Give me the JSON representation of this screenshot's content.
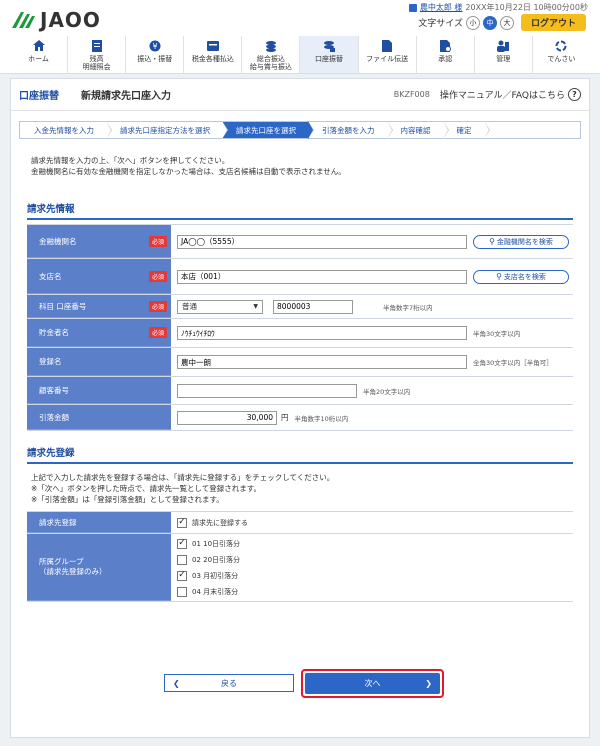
{
  "header": {
    "logo_text": "JAOO",
    "user_name": "農中太郎 様",
    "login_time": "20XX年10月22日 10時00分00秒",
    "font_size_label": "文字サイズ",
    "font_sizes": [
      "小",
      "中",
      "大"
    ],
    "logout": "ログアウト"
  },
  "nav": [
    {
      "icon": "home-icon",
      "label": "ホーム"
    },
    {
      "icon": "balance-icon",
      "label": "残高\n明細照会"
    },
    {
      "icon": "transfer-icon",
      "label": "振込・振替"
    },
    {
      "icon": "payment-icon",
      "label": "税金各種払込"
    },
    {
      "icon": "bulk-transfer-icon",
      "label": "総合振込\n給与賞与振込"
    },
    {
      "icon": "debit-icon",
      "label": "口座振替"
    },
    {
      "icon": "file-icon",
      "label": "ファイル伝送"
    },
    {
      "icon": "approval-icon",
      "label": "承認"
    },
    {
      "icon": "admin-icon",
      "label": "管理"
    },
    {
      "icon": "electronic-icon",
      "label": "でんさい"
    }
  ],
  "page": {
    "category": "口座振替",
    "title": "新規請求先口座入力",
    "code": "BKZF008",
    "help": "操作マニュアル／FAQはこちら"
  },
  "steps": [
    "入金先情報を入力",
    "請求先口座指定方法を選択",
    "請求先口座を選択",
    "引落金額を入力",
    "内容確認",
    "確定"
  ],
  "intro": [
    "請求先情報を入力の上、「次へ」ボタンを押してください。",
    "金融機関名に有効な金融機関を指定しなかった場合は、支店名候補は自動で表示されません。"
  ],
  "section1": {
    "title": "請求先情報",
    "required": "必須",
    "bank_label": "金融機関名",
    "bank_value": "JA◯◯（5555）",
    "bank_search": "金融機関名を検索",
    "branch_label": "支店名",
    "branch_value": "本店（001）",
    "branch_search": "支店名を検索",
    "account_label": "科目 口座番号",
    "account_type": "普通",
    "account_number": "8000003",
    "account_hint": "半角数字7桁以内",
    "holder_label": "貯金者名",
    "holder_value": "ﾉｳﾁｭｳｲﾁﾛｳ",
    "holder_hint": "半角30文字以内",
    "reg_label": "登録名",
    "reg_value": "農中一朗",
    "reg_hint": "全角30文字以内［半角可］",
    "customer_label": "顧客番号",
    "customer_value": "",
    "customer_hint": "半角20文字以内",
    "amount_label": "引落金額",
    "amount_value": "30,000",
    "amount_unit": "円",
    "amount_hint": "半角数字10桁以内"
  },
  "section2": {
    "title": "請求先登録",
    "intro": [
      "上記で入力した請求先を登録する場合は、「請求先に登録する」をチェックしてください。",
      "※「次へ」ボタンを押した時点で、請求先一覧として登録されます。",
      "※「引落金額」は「登録引落金額」として登録されます。"
    ],
    "register_label": "請求先登録",
    "register_check": "請求先に登録する",
    "group_label": "所属グループ",
    "group_sub": "（請求先登録のみ）",
    "groups": [
      {
        "label": "01 10日引落分",
        "checked": true
      },
      {
        "label": "02 20日引落分",
        "checked": false
      },
      {
        "label": "03 月初引落分",
        "checked": true
      },
      {
        "label": "04 月末引落分",
        "checked": false
      }
    ]
  },
  "buttons": {
    "back": "戻る",
    "next": "次へ"
  },
  "colors": {
    "primary": "#2c67c8",
    "label_bg": "#5b7fc9",
    "required": "#e03a3a",
    "highlight": "#e0192f",
    "logout": "#f4bc1c"
  }
}
